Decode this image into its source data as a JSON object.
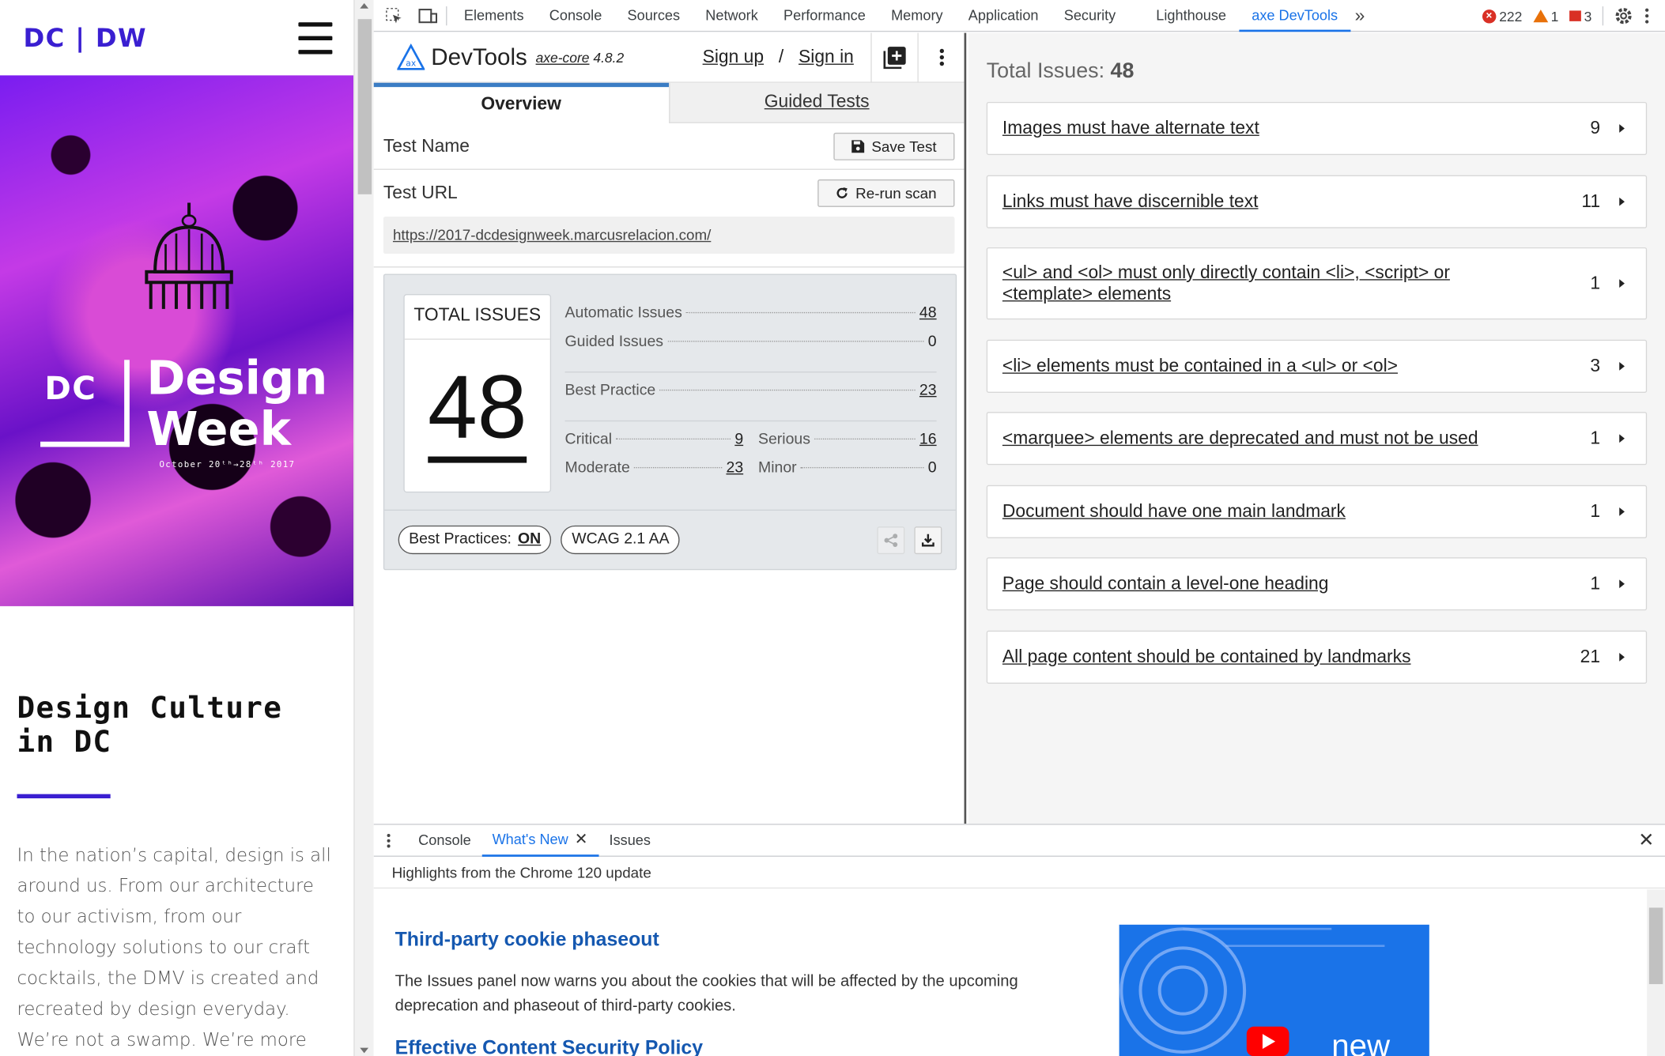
{
  "site": {
    "logo": "DC | DW",
    "hero": {
      "dc": "DC",
      "line1": "Design",
      "line2": "Week",
      "date": "October 20ᵗʰ→28ᵗʰ 2017"
    },
    "heading": "Design Culture in DC",
    "paragraph": "In the nation’s capital, design is all around us. From our architecture to our activism, from our technology solutions to our craft cocktails, the DMV is created and recreated by design everyday. We’re not a swamp. We’re more intentional"
  },
  "devtools": {
    "tabs": [
      "Elements",
      "Console",
      "Sources",
      "Network",
      "Performance",
      "Memory",
      "Application",
      "Security",
      "Lighthouse",
      "axe DevTools"
    ],
    "active_tab": "axe DevTools",
    "errors": "222",
    "warnings": "1",
    "issues": "3"
  },
  "axe": {
    "title": "DevTools",
    "core_label": "axe-core",
    "core_version": "4.8.2",
    "sign_up": "Sign up",
    "slash": "/",
    "sign_in": "Sign in",
    "tab_overview": "Overview",
    "tab_guided": "Guided Tests",
    "test_name_label": "Test Name",
    "save_test": "Save Test",
    "test_url_label": "Test URL",
    "rerun_scan": "Re-run scan",
    "test_url": "https://2017-dcdesignweek.marcusrelacion.com/",
    "total_issues_label": "TOTAL ISSUES",
    "total_issues": "48",
    "stats": {
      "automatic_label": "Automatic Issues",
      "automatic": "48",
      "guided_label": "Guided Issues",
      "guided": "0",
      "best_practice_label": "Best Practice",
      "best_practice": "23",
      "critical_label": "Critical",
      "critical": "9",
      "serious_label": "Serious",
      "serious": "16",
      "moderate_label": "Moderate",
      "moderate": "23",
      "minor_label": "Minor",
      "minor": "0"
    },
    "best_practices_label": "Best Practices:",
    "best_practices_value": "ON",
    "wcag": "WCAG 2.1 AA"
  },
  "issues_panel": {
    "title_label": "Total Issues:",
    "title_count": "48",
    "items": [
      {
        "name": "Images must have alternate text",
        "count": "9"
      },
      {
        "name": "Links must have discernible text",
        "count": "11"
      },
      {
        "name": "<ul> and <ol> must only directly contain <li>, <script> or <template> elements",
        "count": "1"
      },
      {
        "name": "<li> elements must be contained in a <ul> or <ol>",
        "count": "3"
      },
      {
        "name": "<marquee> elements are deprecated and must not be used",
        "count": "1"
      },
      {
        "name": "Document should have one main landmark",
        "count": "1"
      },
      {
        "name": "Page should contain a level-one heading",
        "count": "1"
      },
      {
        "name": "All page content should be contained by landmarks",
        "count": "21"
      }
    ]
  },
  "drawer": {
    "tabs": [
      "Console",
      "What's New",
      "Issues"
    ],
    "active_tab": "What's New",
    "subtitle": "Highlights from the Chrome 120 update",
    "h1": "Third-party cookie phaseout",
    "p1": "The Issues panel now warns you about the cookies that will be affected by the upcoming deprecation and phaseout of third-party cookies.",
    "h2": "Effective Content Security Policy",
    "video_label": "new"
  },
  "colors": {
    "accent": "#1a73e8",
    "brand": "#3a1fd1",
    "axe_blue": "#3b7dc4"
  }
}
